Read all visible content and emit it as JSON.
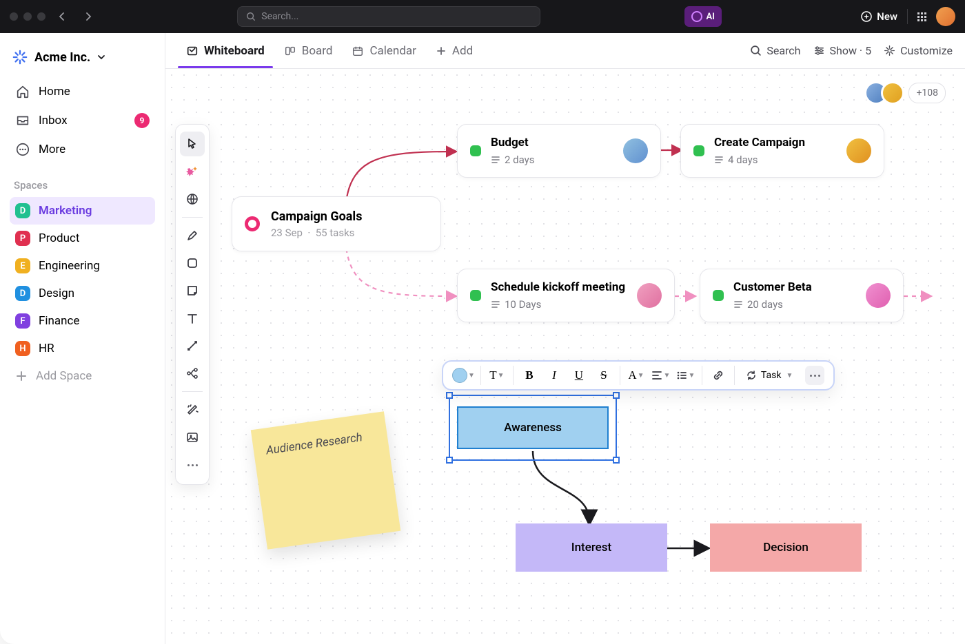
{
  "titlebar": {
    "search_placeholder": "Search...",
    "ai_label": "AI",
    "new_label": "New"
  },
  "workspace": {
    "name": "Acme Inc."
  },
  "nav": {
    "home": "Home",
    "inbox": "Inbox",
    "inbox_count": "9",
    "more": "More"
  },
  "spaces": {
    "heading": "Spaces",
    "add_label": "Add Space",
    "items": [
      {
        "letter": "D",
        "label": "Marketing",
        "color": "#20c090"
      },
      {
        "letter": "P",
        "label": "Product",
        "color": "#e03050"
      },
      {
        "letter": "E",
        "label": "Engineering",
        "color": "#f0b020"
      },
      {
        "letter": "D",
        "label": "Design",
        "color": "#2090e0"
      },
      {
        "letter": "F",
        "label": "Finance",
        "color": "#8040e0"
      },
      {
        "letter": "H",
        "label": "HR",
        "color": "#f06020"
      }
    ]
  },
  "views": {
    "whiteboard": "Whiteboard",
    "board": "Board",
    "calendar": "Calendar",
    "add": "Add"
  },
  "viewbar_right": {
    "search": "Search",
    "show": "Show · 5",
    "customize": "Customize"
  },
  "presence": {
    "more": "+108"
  },
  "cards": {
    "goals": {
      "title": "Campaign Goals",
      "date": "23 Sep",
      "tasks": "55 tasks"
    },
    "budget": {
      "title": "Budget",
      "duration": "2 days"
    },
    "create": {
      "title": "Create Campaign",
      "duration": "4 days"
    },
    "kickoff": {
      "title": "Schedule kickoff meeting",
      "duration": "10 Days"
    },
    "beta": {
      "title": "Customer Beta",
      "duration": "20 days"
    }
  },
  "sticky": {
    "text": "Audience Research"
  },
  "shapes": {
    "awareness": "Awareness",
    "interest": "Interest",
    "decision": "Decision"
  },
  "format_toolbar": {
    "task_label": "Task"
  }
}
